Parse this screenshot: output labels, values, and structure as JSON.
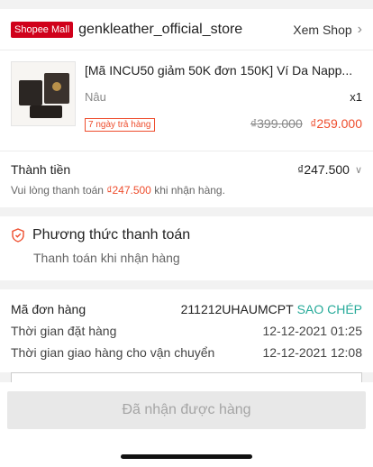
{
  "shop": {
    "badge": "Shopee Mall",
    "name": "genkleather_official_store",
    "view_label": "Xem Shop"
  },
  "product": {
    "title": "[Mã INCU50 giảm 50K đơn 150K] Ví Da Napp...",
    "variant": "Nâu",
    "quantity": "x1",
    "return_tag": "7 ngày trả hàng",
    "original_price": "₫399.000",
    "sale_price": "₫259.000"
  },
  "total": {
    "label": "Thành tiền",
    "amount": "₫247.500",
    "note_prefix": "Vui lòng thanh toán ",
    "note_amount": "₫247.500",
    "note_suffix": " khi nhận hàng."
  },
  "payment": {
    "title": "Phương thức thanh toán",
    "method": "Thanh toán khi nhận hàng"
  },
  "order": {
    "id_label": "Mã đơn hàng",
    "id_value": "211212UHAUMCPT",
    "copy_label": "SAO CHÉP",
    "placed_label": "Thời gian đặt hàng",
    "placed_value": "12-12-2021 01:25",
    "shipped_label": "Thời gian giao hàng cho vận chuyển",
    "shipped_value": "12-12-2021 12:08"
  },
  "bottom": {
    "received_button": "Đã nhận được hàng"
  },
  "colors": {
    "accent": "#ee4d2d",
    "mall_red": "#d0011b",
    "copy_teal": "#26aa99"
  }
}
